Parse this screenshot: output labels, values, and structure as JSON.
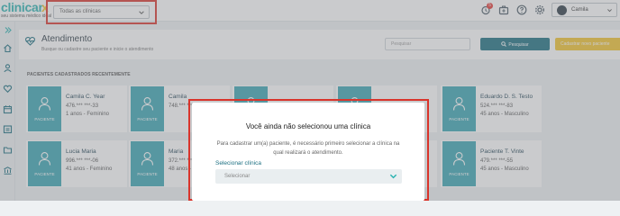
{
  "brand": {
    "logo_main": "clinicar",
    "logo_accent": "x",
    "logo_sub": "seu sistema médico ideal"
  },
  "topbar": {
    "clinic_select": "Todas as clínicas",
    "notification_count": "5",
    "user_name": "Camila"
  },
  "header": {
    "title": "Atendimento",
    "subtitle": "Busque ou cadastre seu paciente e inicie o atendimento",
    "search_placeholder": "Pesquisar",
    "search_button": "Pesquisar",
    "register_button": "Cadastrar novo paciente"
  },
  "section": {
    "title": "PACIENTES CADASTRADOS RECENTEMENTE"
  },
  "patient_photo_label": "PACIENTE",
  "patients": [
    {
      "name": "Camila C. Year",
      "phone": "476.*** ***-33",
      "info": "1 anos - Feminino"
    },
    {
      "name": "Camila",
      "phone": "748.*** ***-",
      "info": ""
    },
    {
      "name": "",
      "phone": "",
      "info": ""
    },
    {
      "name": "",
      "phone": "",
      "info": ""
    },
    {
      "name": "Eduardo D. S. Testo",
      "phone": "524.*** ***-83",
      "info": "45 anos - Masculino"
    },
    {
      "name": "Lucia Maria",
      "phone": "996.*** ***-06",
      "info": "41 anos - Feminino"
    },
    {
      "name": "Maria",
      "phone": "372.*** ***-",
      "info": "48 anos - Fe"
    },
    {
      "name": "",
      "phone": "",
      "info": ""
    },
    {
      "name": "",
      "phone": "",
      "info": ""
    },
    {
      "name": "Paciente T. Vinte",
      "phone": "479.*** ***-55",
      "info": "45 anos - Masculino"
    }
  ],
  "modal": {
    "title": "Você ainda não selecionou uma clínica",
    "text": "Para cadastrar um(a) paciente, é necessário primeiro selecionar a clínica na qual realizará o atendimento.",
    "field_label": "Selecionar clínica",
    "select_placeholder": "Selecionar"
  },
  "colors": {
    "brand_teal": "#2bb3b1",
    "brand_yellow": "#f3c42d",
    "primary_button": "#1a6e80",
    "card_photo_bg": "#3aa6b3",
    "highlight_red": "#d9342b"
  },
  "icons": {
    "sidebar": [
      "menu-icon",
      "home-icon",
      "patients-icon",
      "heart-icon",
      "calendar-icon",
      "schedule-icon",
      "folder-icon",
      "finance-icon"
    ],
    "topbar": [
      "alarm-icon",
      "medical-bag-icon",
      "help-icon",
      "settings-icon"
    ]
  }
}
